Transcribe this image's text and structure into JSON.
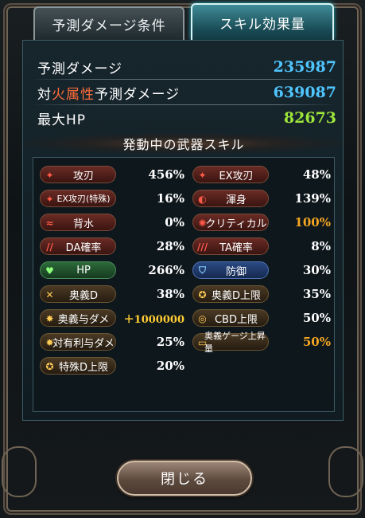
{
  "tabs": [
    {
      "label": "予測ダメージ条件",
      "active": false
    },
    {
      "label": "スキル効果量",
      "active": true
    }
  ],
  "stats": {
    "predicted_damage": {
      "label": "予測ダメージ",
      "value": "235987"
    },
    "fire_damage": {
      "label_prefix": "対",
      "label_fire": "火属性",
      "label_suffix": "予測ダメージ",
      "value": "639087"
    },
    "max_hp": {
      "label": "最大HP",
      "value": "82673"
    }
  },
  "section_title": "発動中の武器スキル",
  "skills_left": [
    {
      "name": "攻刃",
      "value": "456%",
      "icon": "sword-icon",
      "style": "red"
    },
    {
      "name": "EX攻刃(特殊)",
      "value": "16%",
      "icon": "sword-icon",
      "style": "red"
    },
    {
      "name": "背水",
      "value": "0%",
      "icon": "wave-icon",
      "style": "red"
    },
    {
      "name": "DA確率",
      "value": "28%",
      "icon": "double-slash-icon",
      "style": "red"
    },
    {
      "name": "HP",
      "value": "266%",
      "icon": "heart-icon",
      "style": "green"
    },
    {
      "name": "奥義D",
      "value": "38%",
      "icon": "cross-swords-icon",
      "style": "gold"
    },
    {
      "name": "奥義与ダメ",
      "value": "＋1000000",
      "icon": "ougi-icon",
      "style": "gold"
    },
    {
      "name": "対有利与ダメ",
      "value": "25%",
      "icon": "gear-icon",
      "style": "gold"
    },
    {
      "name": "特殊D上限",
      "value": "20%",
      "icon": "star-icon",
      "style": "gold"
    }
  ],
  "skills_right": [
    {
      "name": "EX攻刃",
      "value": "48%",
      "icon": "sword-icon",
      "style": "red"
    },
    {
      "name": "渾身",
      "value": "139%",
      "icon": "flex-icon",
      "style": "red"
    },
    {
      "name": "クリティカル",
      "value": "100%",
      "icon": "burst-icon",
      "style": "red"
    },
    {
      "name": "TA確率",
      "value": "8%",
      "icon": "triple-slash-icon",
      "style": "red"
    },
    {
      "name": "防御",
      "value": "30%",
      "icon": "shield-icon",
      "style": "blue"
    },
    {
      "name": "奥義D上限",
      "value": "35%",
      "icon": "star-icon",
      "style": "gold"
    },
    {
      "name": "CBD上限",
      "value": "50%",
      "icon": "cb-icon",
      "style": "gold"
    },
    {
      "name": "奥義ゲージ上昇量",
      "value": "50%",
      "icon": "gauge-icon",
      "style": "gold"
    }
  ],
  "colors": {
    "highlight_orange": "#f5a623",
    "damage_blue": "#4fc5ff",
    "hp_green": "#9ee63a",
    "fire_red": "#ff6d3a"
  },
  "close_button": "閉じる"
}
